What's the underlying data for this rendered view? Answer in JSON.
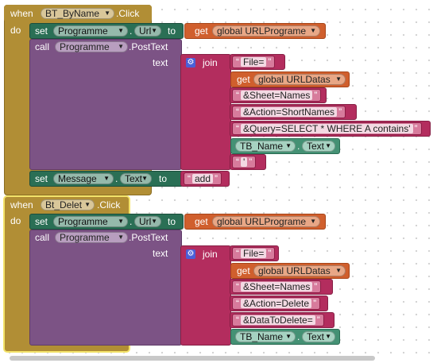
{
  "workspace": {
    "events": [
      {
        "when_label": "when",
        "do_label": "do",
        "component": "BT_ByName",
        "event": ".Click",
        "set_url": {
          "set_label": "set",
          "component": "Programme",
          "property": "Url",
          "to_label": "to",
          "value": {
            "get_label": "get",
            "variable": "global URLPrograme"
          }
        },
        "call": {
          "call_label": "call",
          "component": "Programme",
          "method": ".PostText",
          "param_label": "text",
          "join_label": "join",
          "items": [
            {
              "kind": "text",
              "value": "File="
            },
            {
              "kind": "get",
              "get_label": "get",
              "variable": "global URLDatas"
            },
            {
              "kind": "text",
              "value": "&Sheet=Names"
            },
            {
              "kind": "text",
              "value": "&Action=ShortNames"
            },
            {
              "kind": "text",
              "value": "&Query=SELECT * WHERE A contains'"
            },
            {
              "kind": "component",
              "component": "TB_Name",
              "property": "Text"
            },
            {
              "kind": "text",
              "value": "'"
            }
          ]
        },
        "set_message": {
          "set_label": "set",
          "component": "Message",
          "property": "Text",
          "to_label": "to",
          "value": "add"
        }
      },
      {
        "when_label": "when",
        "do_label": "do",
        "component": "Bt_Delet",
        "event": ".Click",
        "set_url": {
          "set_label": "set",
          "component": "Programme",
          "property": "Url",
          "to_label": "to",
          "value": {
            "get_label": "get",
            "variable": "global URLPrograme"
          }
        },
        "call": {
          "call_label": "call",
          "component": "Programme",
          "method": ".PostText",
          "param_label": "text",
          "join_label": "join",
          "items": [
            {
              "kind": "text",
              "value": "File="
            },
            {
              "kind": "get",
              "get_label": "get",
              "variable": "global URLDatas"
            },
            {
              "kind": "text",
              "value": "&Sheet=Names"
            },
            {
              "kind": "text",
              "value": "&Action=Delete"
            },
            {
              "kind": "text",
              "value": "&DataToDelete="
            },
            {
              "kind": "component",
              "component": "TB_Name",
              "property": "Text"
            }
          ]
        }
      }
    ],
    "colors": {
      "event": "#b18e35",
      "procedure": "#7c5385",
      "setter": "#2a6f55",
      "text": "#b32d5e",
      "global_get": "#d05f2d",
      "component_get": "#449174"
    },
    "icons": {
      "dropdown": "triangle-down",
      "mutator": "gear-icon"
    }
  }
}
